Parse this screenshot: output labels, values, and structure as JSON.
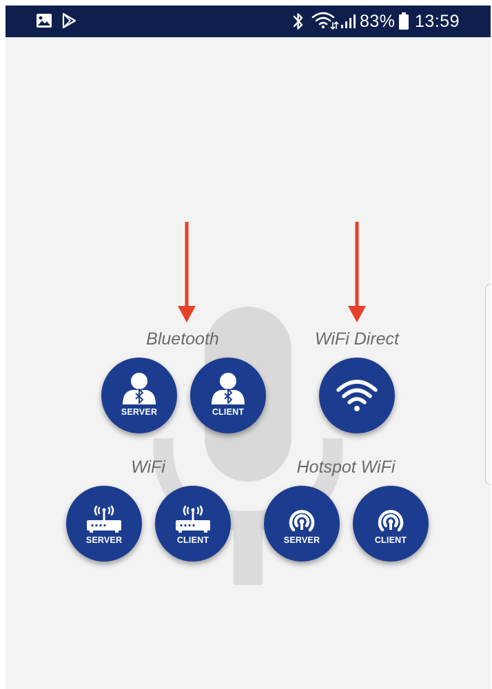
{
  "status_bar": {
    "left_icons": [
      "gallery-icon",
      "play-store-icon"
    ],
    "right_icons": [
      "bluetooth-icon",
      "wifi-icon",
      "signal-icon",
      "battery-icon"
    ],
    "battery": "83%",
    "time": "13:59"
  },
  "groups": {
    "bluetooth": {
      "label": "Bluetooth",
      "server_caption": "SERVER",
      "client_caption": "CLIENT"
    },
    "wifi_direct": {
      "label": "WiFi Direct"
    },
    "wifi": {
      "label": "WiFi",
      "server_caption": "SERVER",
      "client_caption": "CLIENT"
    },
    "hotspot": {
      "label": "Hotspot WiFi",
      "server_caption": "SERVER",
      "client_caption": "CLIENT"
    }
  },
  "colors": {
    "status_bar": "#0f1f4d",
    "button": "#1c3d8f",
    "arrow": "#e5412b",
    "label": "#6b6b6b",
    "background": "#f3f3f3",
    "mic_watermark": "#dadada"
  }
}
